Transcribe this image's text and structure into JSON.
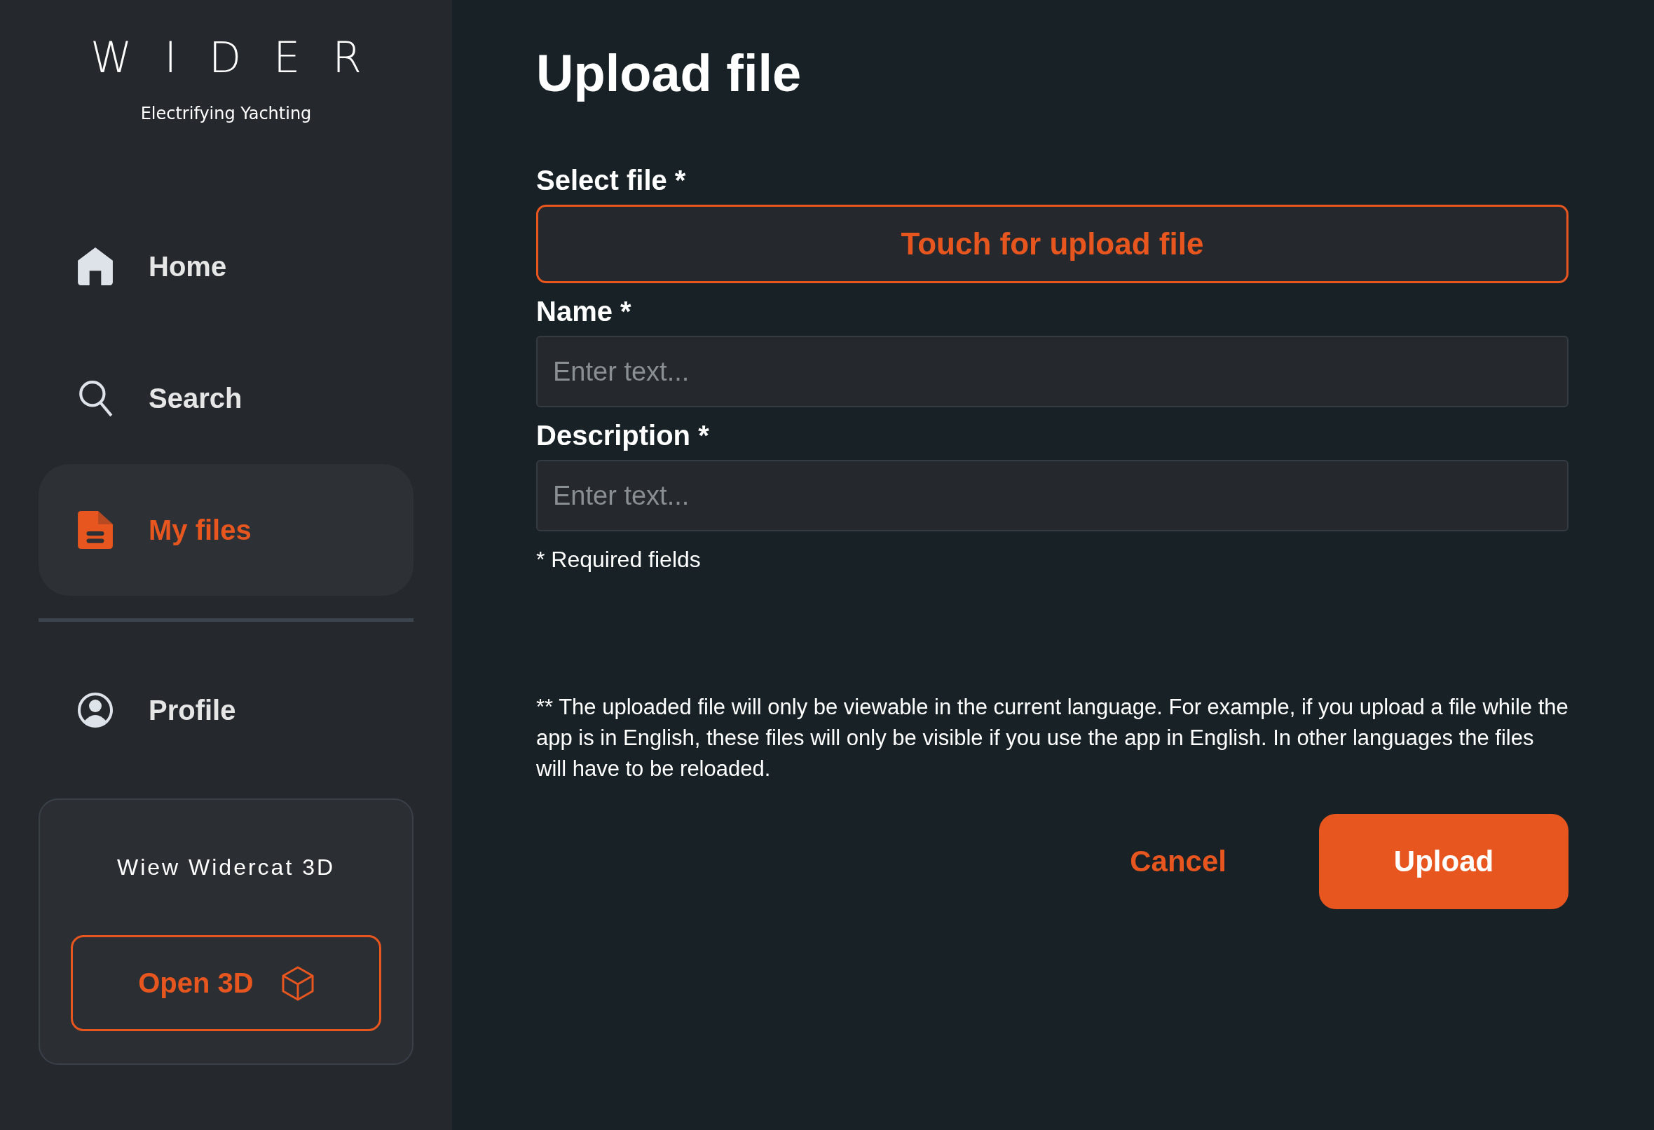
{
  "brand": {
    "logo": "WIDER",
    "tagline": "Electrifying Yachting"
  },
  "nav": [
    {
      "kind": "home",
      "label": "Home",
      "selected": false
    },
    {
      "kind": "search",
      "label": "Search",
      "selected": false
    },
    {
      "kind": "file",
      "label": "My files",
      "selected": true
    }
  ],
  "account_nav": [
    {
      "kind": "profile",
      "label": "Profile",
      "selected": false
    }
  ],
  "viewer_card": {
    "title": "Wiew Widercat 3D",
    "button": "Open 3D"
  },
  "page": {
    "title": "Upload file",
    "fields": [
      {
        "kind": "file",
        "label": "Select file *",
        "value": "Touch for upload file"
      },
      {
        "kind": "text",
        "label": "Name *",
        "placeholder": "Enter text..."
      },
      {
        "kind": "text",
        "label": "Description *",
        "placeholder": "Enter text..."
      }
    ],
    "required_note": "* Required fields",
    "language_note": "** The uploaded file will only be viewable in the current language. For example, if you upload a file while the app is in English, these files will only be visible if you use the app in English. In other languages the files will have to be reloaded.",
    "buttons": [
      {
        "kind": "secondary",
        "label": "Cancel"
      },
      {
        "kind": "primary",
        "label": "Upload"
      }
    ]
  }
}
